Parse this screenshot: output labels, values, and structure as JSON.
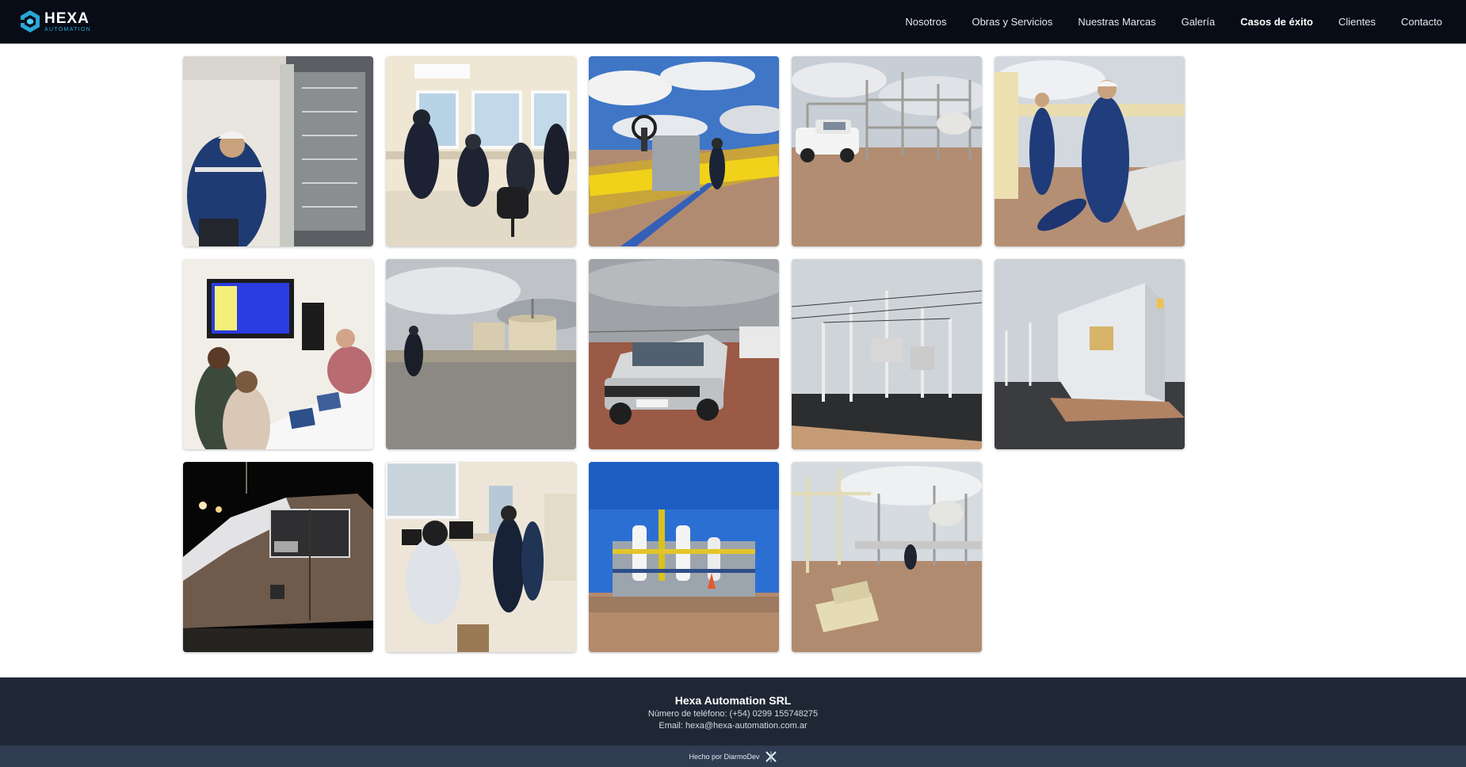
{
  "brand": {
    "name": "HEXA",
    "tagline": "AUTOMATION",
    "icon": "hexagon-logo-icon",
    "accent_color": "#27a7d6"
  },
  "nav": {
    "items": [
      {
        "label": "Nosotros",
        "active": false
      },
      {
        "label": "Obras y Servicios",
        "active": false
      },
      {
        "label": "Nuestras Marcas",
        "active": false
      },
      {
        "label": "Galería",
        "active": false
      },
      {
        "label": "Casos de éxito",
        "active": true
      },
      {
        "label": "Clientes",
        "active": false
      },
      {
        "label": "Contacto",
        "active": false
      }
    ]
  },
  "gallery": {
    "photo_count": 14,
    "photos": [
      {
        "scene": "control-panel-wiring"
      },
      {
        "scene": "control-room-workers"
      },
      {
        "scene": "yellow-pipeline-valve"
      },
      {
        "scene": "pickup-at-facility"
      },
      {
        "scene": "workers-on-pipeline"
      },
      {
        "scene": "training-classroom"
      },
      {
        "scene": "worker-walking-to-tanks"
      },
      {
        "scene": "pickup-truck-desert"
      },
      {
        "scene": "electrical-substation"
      },
      {
        "scene": "control-shelter"
      },
      {
        "scene": "frosted-truck-night"
      },
      {
        "scene": "operators-at-computers"
      },
      {
        "scene": "gas-plant-blue-sky"
      },
      {
        "scene": "pipe-rack-construction"
      }
    ]
  },
  "footer": {
    "company": "Hexa Automation SRL",
    "phone": "Número de teléfono: (+54) 0299 155748275",
    "email": "Email: hexa@hexa-automation.com.ar",
    "credit": "Hecho por DiarmoDev",
    "credit_icon": "diarmodev-logo-icon",
    "background": "#1f2735",
    "credit_background": "#303c52"
  },
  "colors": {
    "header": "#070c17"
  }
}
